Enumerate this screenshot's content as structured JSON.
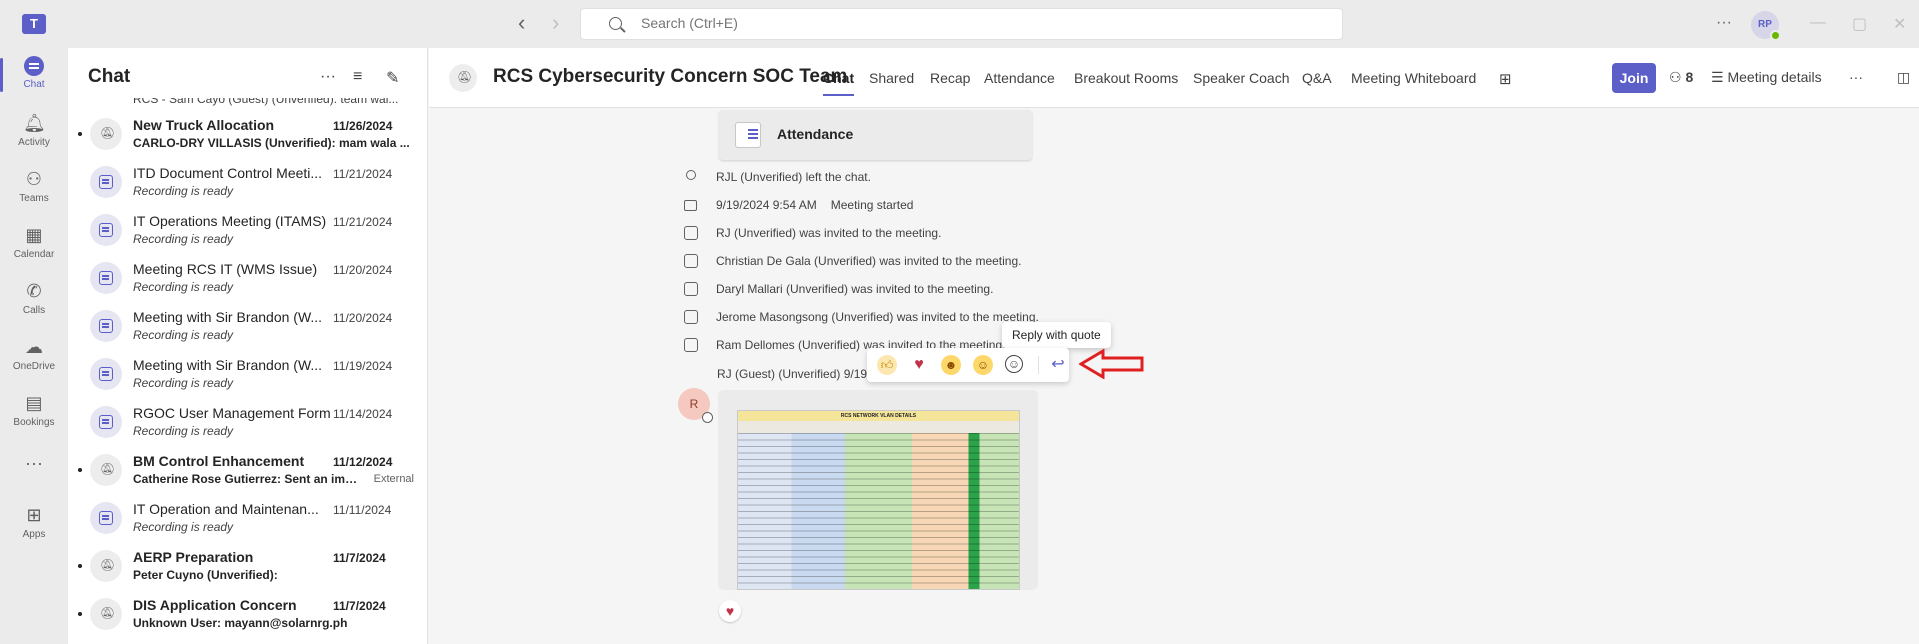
{
  "search": {
    "placeholder": "Search (Ctrl+E)"
  },
  "user": {
    "initials": "RP"
  },
  "app_bar": [
    {
      "label": "Chat",
      "icon": "chat-icon"
    },
    {
      "label": "Activity",
      "icon": "bell-icon"
    },
    {
      "label": "Teams",
      "icon": "teams-icon"
    },
    {
      "label": "Calendar",
      "icon": "calendar-icon"
    },
    {
      "label": "Calls",
      "icon": "phone-icon"
    },
    {
      "label": "OneDrive",
      "icon": "cloud-icon"
    },
    {
      "label": "Bookings",
      "icon": "bookings-icon"
    },
    {
      "label": "Apps",
      "icon": "add-apps-icon"
    }
  ],
  "chat_list": {
    "title": "Chat",
    "partial_top": "RCS - Sam Cayo (Guest) (Unverified): team wai...",
    "items": [
      {
        "name": "New Truck Allocation",
        "date": "11/26/2024",
        "sub": "CARLO-DRY VILLASIS (Unverified): mam wala ...",
        "unread": true
      },
      {
        "name": "ITD Document Control Meeti...",
        "date": "11/21/2024",
        "sub": "Recording is ready",
        "unread": false
      },
      {
        "name": "IT Operations Meeting (ITAMS)",
        "date": "11/21/2024",
        "sub": "Recording is ready",
        "unread": false
      },
      {
        "name": "Meeting RCS IT (WMS Issue)",
        "date": "11/20/2024",
        "sub": "Recording is ready",
        "unread": false
      },
      {
        "name": "Meeting with Sir Brandon (W...",
        "date": "11/20/2024",
        "sub": "Recording is ready",
        "unread": false
      },
      {
        "name": "Meeting with Sir Brandon (W...",
        "date": "11/19/2024",
        "sub": "Recording is ready",
        "unread": false
      },
      {
        "name": "RGOC User Management Form",
        "date": "11/14/2024",
        "sub": "Recording is ready",
        "unread": false
      },
      {
        "name": "BM Control Enhancement",
        "date": "11/12/2024",
        "sub": "Catherine Rose Gutierrez: Sent an image",
        "unread": true,
        "badge": "External"
      },
      {
        "name": "IT Operation and Maintenan...",
        "date": "11/11/2024",
        "sub": "Recording is ready",
        "unread": false
      },
      {
        "name": "AERP Preparation",
        "date": "11/7/2024",
        "sub": "Peter Cuyno (Unverified):",
        "unread": true
      },
      {
        "name": "DIS Application Concern",
        "date": "11/7/2024",
        "sub": "Unknown User: mayann@solarnrg.ph",
        "unread": true
      }
    ]
  },
  "header": {
    "title": "RCS Cybersecurity Concern SOC Team",
    "tabs": [
      "Chat",
      "Shared",
      "Recap",
      "Attendance",
      "Breakout Rooms",
      "Speaker Coach",
      "Q&A",
      "Meeting Whiteboard"
    ],
    "join_label": "Join",
    "participants": "8",
    "details_label": "Meeting details"
  },
  "conversation": {
    "attendance_card": "Attendance",
    "events": [
      {
        "text": "RJL (Unverified) left the chat.",
        "icon": "person-left-icon"
      },
      {
        "text": "9/19/2024 9:54 AM",
        "extra": "Meeting started",
        "icon": "video-icon"
      },
      {
        "text": "RJ (Unverified) was invited to the meeting.",
        "icon": "invite-icon"
      },
      {
        "text": "Christian De Gala (Unverified) was invited to the meeting.",
        "icon": "invite-icon"
      },
      {
        "text": "Daryl Mallari (Unverified) was invited to the meeting.",
        "icon": "invite-icon"
      },
      {
        "text": "Jerome Masongsong (Unverified) was invited to the meeting.",
        "icon": "invite-icon"
      },
      {
        "text": "Ram Dellomes (Unverified) was invited to the meeting.",
        "icon": "invite-icon"
      }
    ],
    "sender": "RJ (Guest) (Unverified)   9/19",
    "sender_initial": "R",
    "image_title": "RCS NETWORK VLAN DETAILS",
    "tooltip": "Reply with quote",
    "reactions": [
      "like-emoji-icon",
      "heart-emoji-icon",
      "laugh-emoji-icon",
      "surprised-emoji-icon",
      "add-reaction-icon"
    ],
    "message_reaction": "heart-emoji-icon"
  },
  "colors": {
    "accent": "#5b5fc7",
    "arrow": "#e02020",
    "heart": "#c4314b"
  }
}
